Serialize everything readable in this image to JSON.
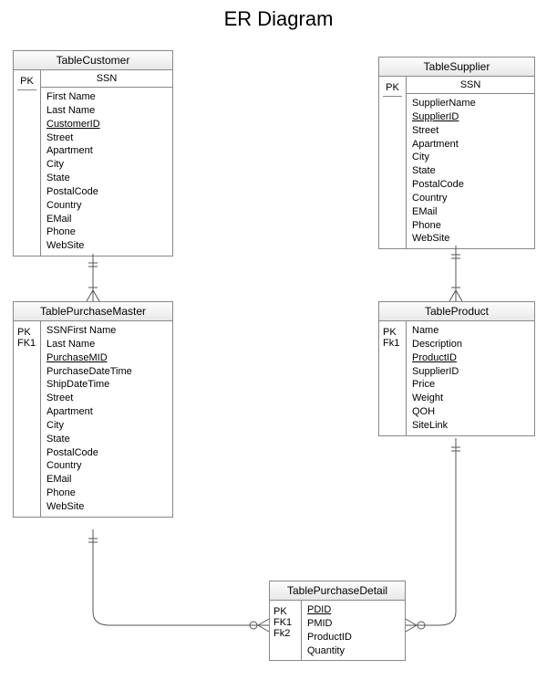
{
  "title": "ER Diagram",
  "entities": {
    "customer": {
      "name": "TableCustomer",
      "pk": "PK",
      "sub": "SSN",
      "attrs": [
        "First Name",
        "Last Name",
        "CustomerID",
        "Street",
        "Apartment",
        "City",
        "State",
        "PostalCode",
        "Country",
        "EMail",
        "Phone",
        "WebSite"
      ],
      "underlined": [
        "CustomerID"
      ],
      "connects_to": [
        "purchaseMaster"
      ]
    },
    "supplier": {
      "name": "TableSupplier",
      "pk": "PK",
      "sub": "SSN",
      "attrs": [
        "SupplierName",
        "SupplierID",
        "Street",
        "Apartment",
        "City",
        "State",
        "PostalCode",
        "Country",
        "EMail",
        "Phone",
        "WebSite"
      ],
      "underlined": [
        "SupplierID"
      ],
      "connects_to": [
        "product"
      ]
    },
    "purchaseMaster": {
      "name": "TablePurchaseMaster",
      "keys": [
        "PK",
        "FK1"
      ],
      "attrs": [
        "SSNFirst Name",
        "Last Name",
        "PurchaseMID",
        "PurchaseDateTime",
        "ShipDateTime",
        "Street",
        "Apartment",
        "City",
        "State",
        "PostalCode",
        "Country",
        "EMail",
        "Phone",
        "WebSite"
      ],
      "underlined": [
        "PurchaseMID"
      ],
      "connects_to": [
        "purchaseDetail"
      ]
    },
    "product": {
      "name": "TableProduct",
      "keys": [
        "PK",
        "Fk1"
      ],
      "attrs": [
        "Name",
        "Description",
        "ProductID",
        "SupplierID",
        "Price",
        "Weight",
        "QOH",
        "SiteLink"
      ],
      "underlined": [
        "ProductID"
      ],
      "connects_to": [
        "purchaseDetail"
      ]
    },
    "purchaseDetail": {
      "name": "TablePurchaseDetail",
      "keys": [
        "PK",
        "FK1",
        "Fk2"
      ],
      "attrs": [
        "PDID",
        "PMID",
        "ProductID",
        "Quantity"
      ],
      "underlined": [
        "PDID"
      ]
    }
  }
}
